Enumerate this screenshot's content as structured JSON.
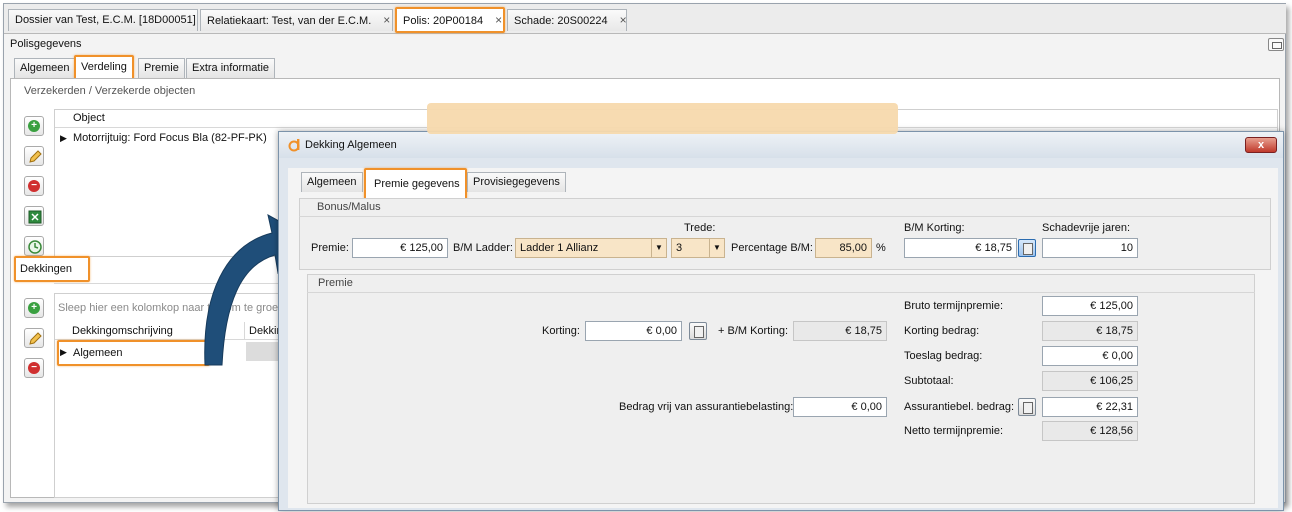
{
  "doc_tabs": [
    {
      "label": "Dossier van Test,  E.C.M. [18D00051]",
      "closable": false
    },
    {
      "label": "Relatiekaart: Test, van der E.C.M.",
      "closable": true
    },
    {
      "label": "Polis: 20P00184",
      "closable": true
    },
    {
      "label": "Schade: 20S00224",
      "closable": true
    }
  ],
  "close_glyph": "×",
  "panel_title": "Polisgegevens",
  "main_tabs": [
    "Algemeen",
    "Verdeling",
    "Premie",
    "Extra informatie"
  ],
  "verzekerden": {
    "section_title": "Verzekerden / Verzekerde objecten",
    "column_header": "Object",
    "rows": [
      "Motorrijtuig: Ford Focus Bla (82-PF-PK)"
    ]
  },
  "dekkingen": {
    "section_title": "Dekkingen",
    "group_hint": "Sleep hier een kolomkop naar toe om te groepe",
    "columns": [
      "Dekkingomschrijving",
      "Dekkin"
    ],
    "rows": [
      "Algemeen"
    ]
  },
  "icons": {
    "add": "plus-icon",
    "edit": "pencil-icon",
    "delete": "minus-icon",
    "excel": "spreadsheet-icon",
    "history": "clock-icon"
  },
  "dialog": {
    "title": "Dekking Algemeen",
    "close_label": "x",
    "tabs": [
      "Algemeen",
      "Premie gegevens",
      "Provisiegegevens"
    ],
    "bonus_malus": {
      "title": "Bonus/Malus",
      "premie_label": "Premie:",
      "premie_value": "€ 125,00",
      "ladder_label": "B/M Ladder:",
      "ladder_value": "Ladder 1 Allianz",
      "trede_label": "Trede:",
      "trede_value": "3",
      "percentage_label": "Percentage B/M:",
      "percentage_value": "85,00",
      "percent_sign": "%",
      "bm_korting_label": "B/M Korting:",
      "bm_korting_value": "€ 18,75",
      "schadevrije_label": "Schadevrije jaren:",
      "schadevrije_value": "10"
    },
    "premie": {
      "title": "Premie",
      "korting_label": "Korting:",
      "korting_value": "€ 0,00",
      "plus_bm_label": "+ B/M Korting:",
      "plus_bm_value": "€ 18,75",
      "vrij_label": "Bedrag vrij van assurantiebelasting:",
      "vrij_value": "€ 0,00",
      "bruto_label": "Bruto termijnpremie:",
      "bruto_value": "€ 125,00",
      "korting_bedrag_label": "Korting bedrag:",
      "korting_bedrag_value": "€ 18,75",
      "toeslag_label": "Toeslag bedrag:",
      "toeslag_value": "€ 0,00",
      "subtotaal_label": "Subtotaal:",
      "subtotaal_value": "€ 106,25",
      "assurantie_label": "Assurantiebel. bedrag:",
      "assurantie_value": "€ 22,31",
      "netto_label": "Netto termijnpremie:",
      "netto_value": "€ 128,56"
    }
  },
  "colors": {
    "highlight": "#f0912a",
    "arrow": "#1f4e79",
    "accent_orange": "#f7d9ad"
  }
}
